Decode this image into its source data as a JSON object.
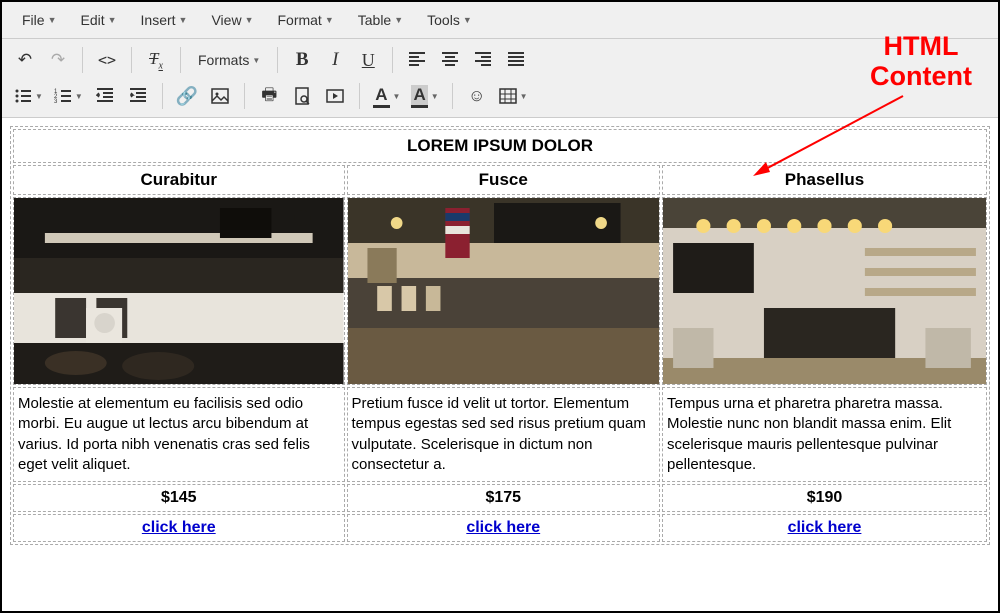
{
  "menubar": {
    "items": [
      "File",
      "Edit",
      "Insert",
      "View",
      "Format",
      "Table",
      "Tools"
    ]
  },
  "toolbar": {
    "formats_label": "Formats"
  },
  "content": {
    "title": "LOREM IPSUM DOLOR",
    "columns": [
      {
        "heading": "Curabitur",
        "desc": "Molestie at elementum eu facilisis sed odio morbi. Eu augue ut lectus arcu bibendum at varius. Id porta nibh venenatis cras sed felis eget velit aliquet.",
        "price": "$145",
        "link": "click here"
      },
      {
        "heading": "Fusce",
        "desc": "Pretium fusce id velit ut tortor. Elementum tempus egestas sed sed risus pretium quam vulputate. Scelerisque in dictum non consectetur a.",
        "price": "$175",
        "link": "click here"
      },
      {
        "heading": "Phasellus",
        "desc": "Tempus urna et pharetra pharetra massa. Molestie nunc non blandit massa enim. Elit scelerisque mauris pellentesque pulvinar pellentesque.",
        "price": "$190",
        "link": "click here"
      }
    ]
  },
  "annotation": {
    "line1": "HTML",
    "line2": "Content"
  }
}
